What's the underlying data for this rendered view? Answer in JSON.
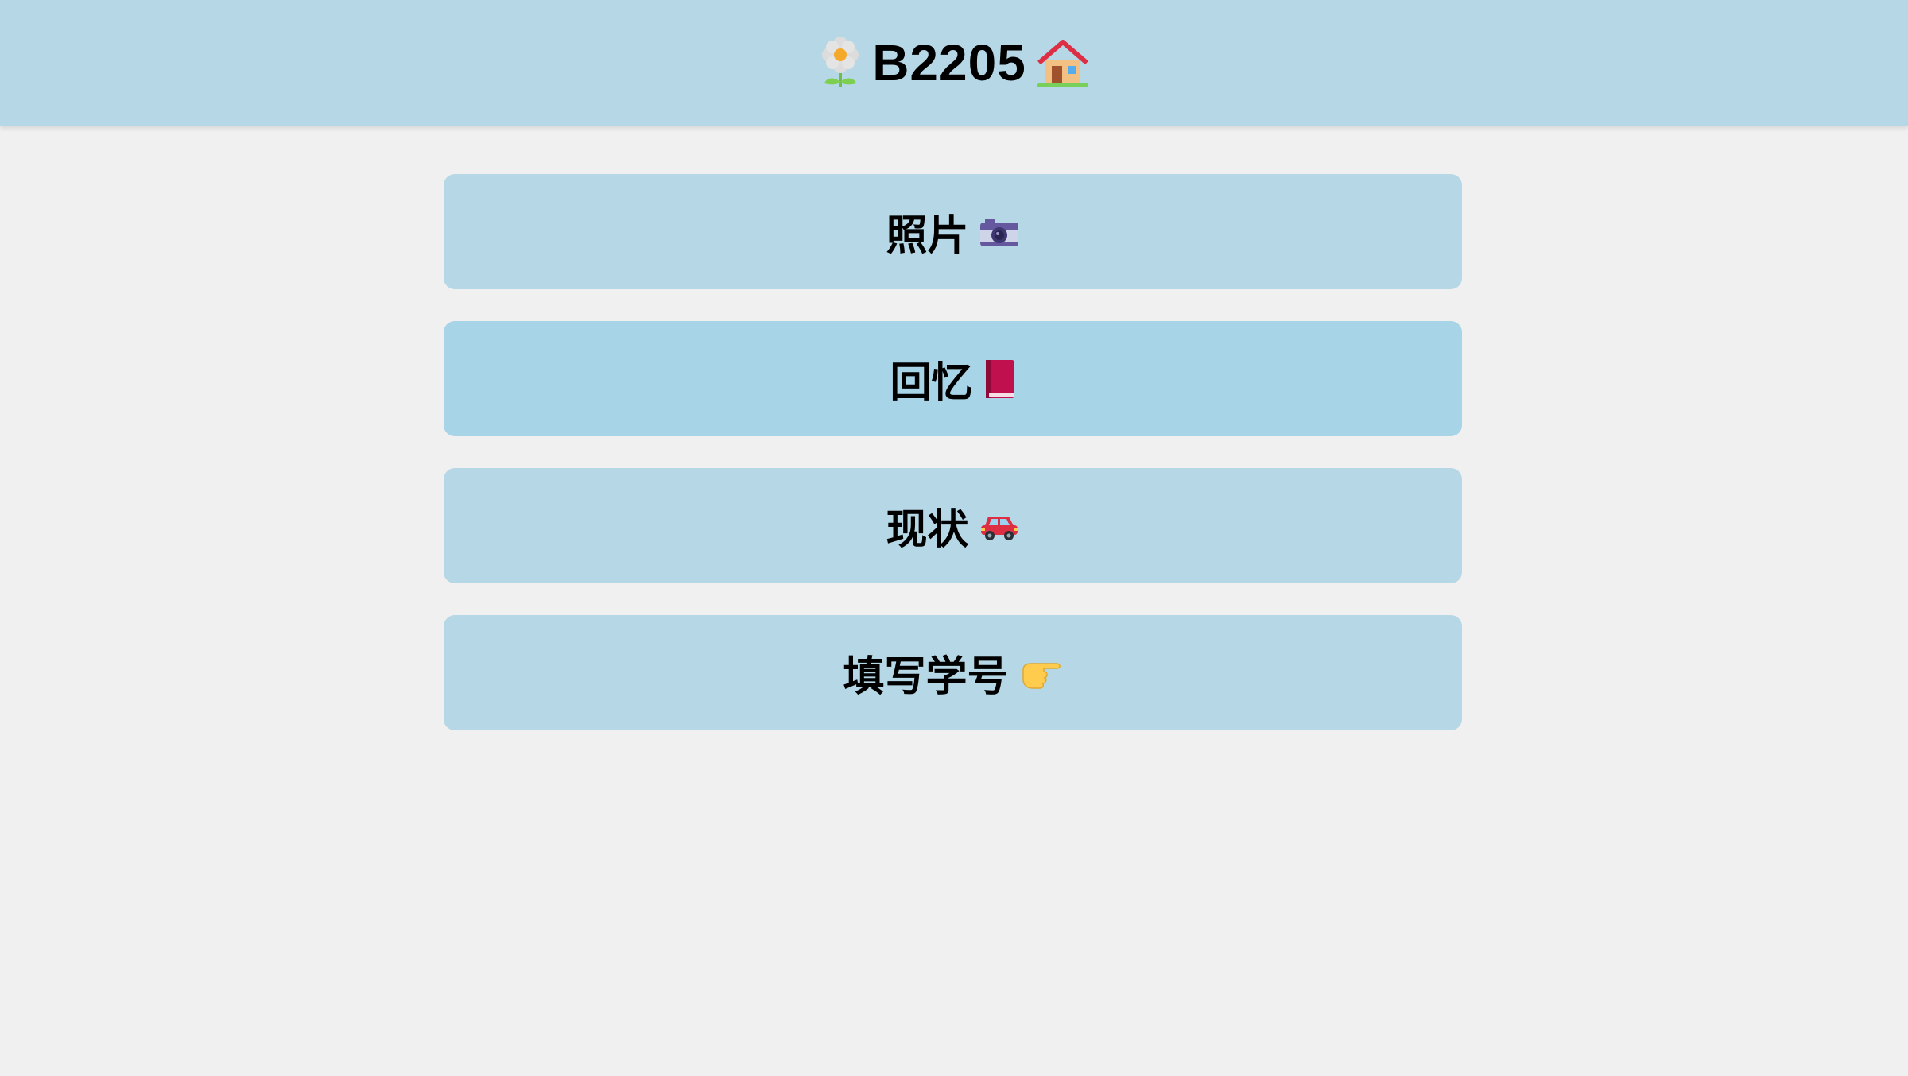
{
  "header": {
    "title": "B2205",
    "left_icon": "flower-icon",
    "right_icon": "house-icon"
  },
  "menu": {
    "items": [
      {
        "label": "照片",
        "icon": "camera-icon"
      },
      {
        "label": "回忆",
        "icon": "book-icon"
      },
      {
        "label": "现状",
        "icon": "car-icon"
      },
      {
        "label": "填写学号",
        "icon": "pointing-hand-icon"
      }
    ]
  },
  "colors": {
    "background": "#f0f0f0",
    "header": "#b6d8e6",
    "button": "#b6d8e6",
    "button_active": "#a7d4e7"
  }
}
